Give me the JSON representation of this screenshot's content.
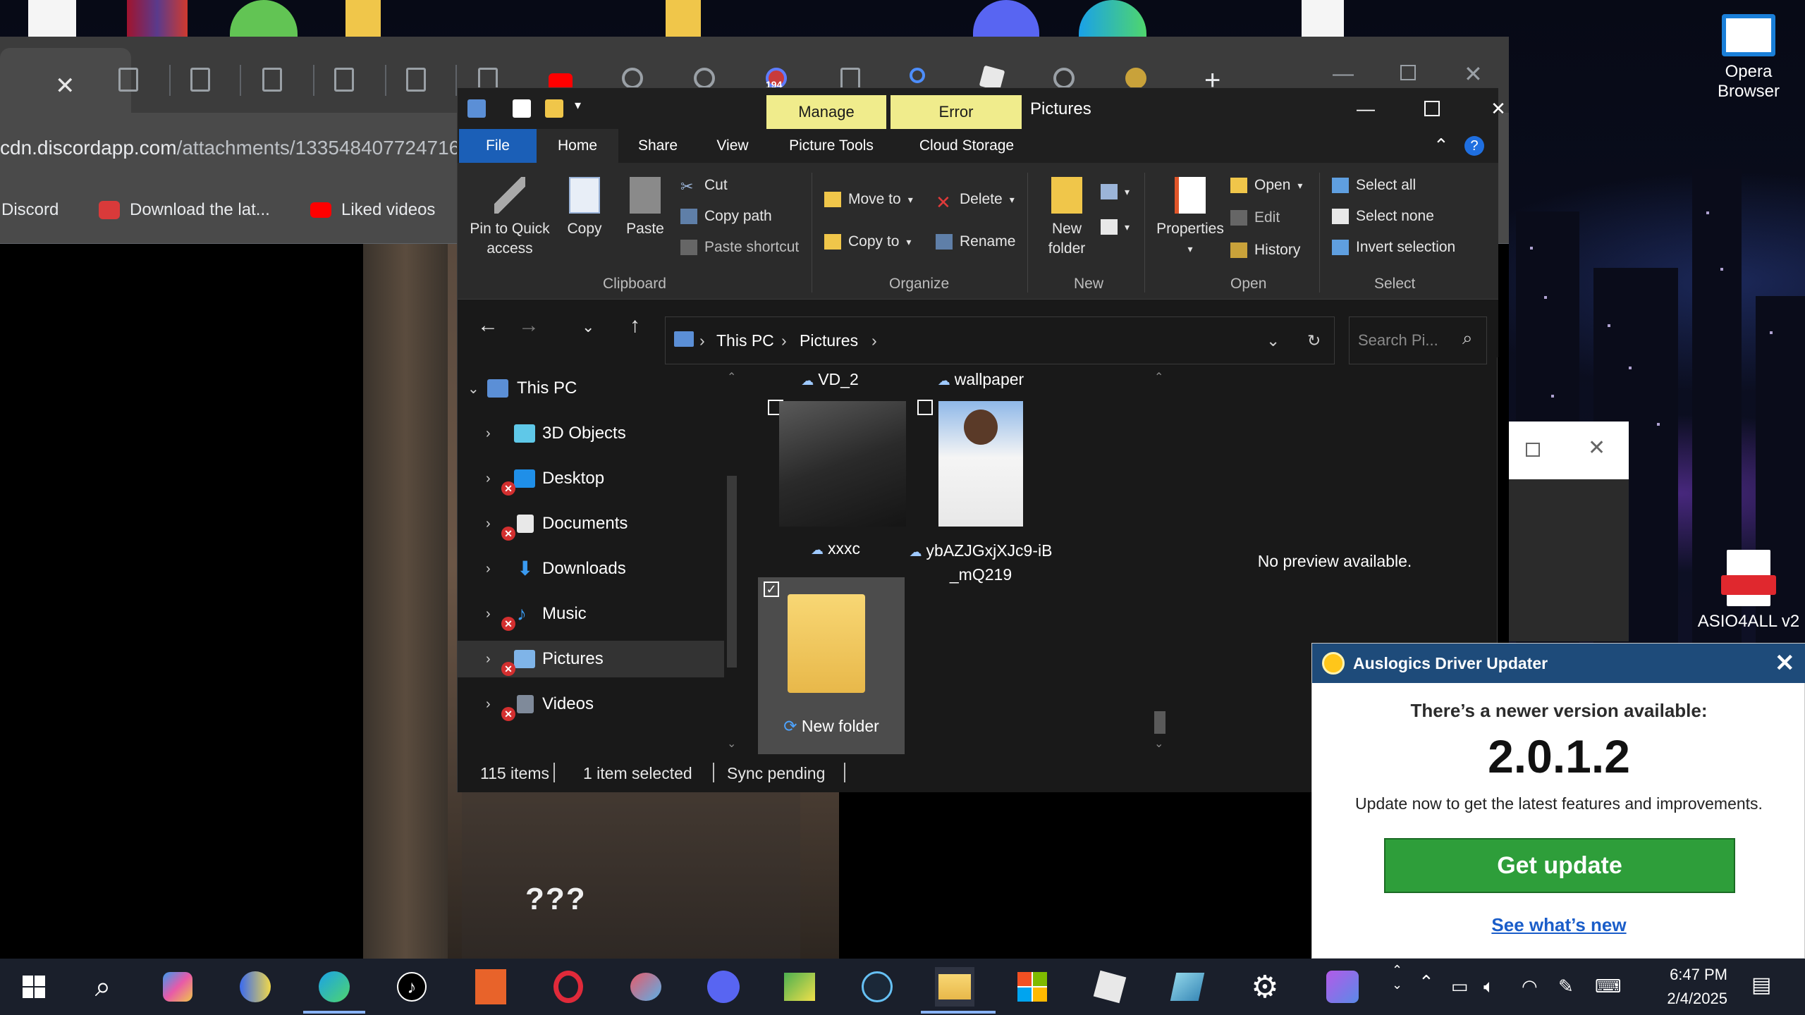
{
  "browser": {
    "url_host": "cdn.discordapp.com",
    "url_path": "/attachments/133548407724716",
    "bookmarks": [
      {
        "label": "Discord"
      },
      {
        "label": "Download the lat..."
      },
      {
        "label": "Liked videos"
      }
    ],
    "tab_badge": "194",
    "video_caption": "???"
  },
  "explorer": {
    "context_tabs": [
      "Manage",
      "Error"
    ],
    "title": "Pictures",
    "menu": [
      "File",
      "Home",
      "Share",
      "View",
      "Picture Tools",
      "Cloud Storage"
    ],
    "ribbon": {
      "clipboard": {
        "pin_label": "Pin to Quick access",
        "copy_label": "Copy",
        "paste_label": "Paste",
        "cut_label": "Cut",
        "copy_path_label": "Copy path",
        "paste_shortcut_label": "Paste shortcut",
        "group_label": "Clipboard"
      },
      "organize": {
        "move_to_label": "Move to",
        "copy_to_label": "Copy to",
        "delete_label": "Delete",
        "rename_label": "Rename",
        "group_label": "Organize"
      },
      "new": {
        "new_folder_label": "New folder",
        "group_label": "New"
      },
      "open": {
        "properties_label": "Properties",
        "open_label": "Open",
        "edit_label": "Edit",
        "history_label": "History",
        "group_label": "Open"
      },
      "select": {
        "select_all_label": "Select all",
        "select_none_label": "Select none",
        "invert_label": "Invert selection",
        "group_label": "Select"
      }
    },
    "breadcrumb": [
      "This PC",
      "Pictures"
    ],
    "search_placeholder": "Search Pi...",
    "nav_tree": [
      {
        "label": "This PC"
      },
      {
        "label": "3D Objects"
      },
      {
        "label": "Desktop"
      },
      {
        "label": "Documents"
      },
      {
        "label": "Downloads"
      },
      {
        "label": "Music"
      },
      {
        "label": "Pictures"
      },
      {
        "label": "Videos"
      }
    ],
    "files": [
      {
        "name": "VD_2"
      },
      {
        "name": "wallpaper"
      },
      {
        "name": "xxxc"
      },
      {
        "name": "ybAZJGxjXJc9-iB_mQ219"
      },
      {
        "name": "New folder"
      }
    ],
    "preview_text": "No preview available.",
    "status": {
      "items": "115 items",
      "selected": "1 item selected",
      "sync": "Sync pending"
    }
  },
  "desktop_icons": [
    {
      "label": "Opera Browser"
    },
    {
      "label": "ASIO4ALL v2"
    }
  ],
  "auslogics": {
    "title": "Auslogics Driver Updater",
    "newer_text": "There’s a newer version available:",
    "version": "2.0.1.2",
    "description": "Update now to get the latest features and improvements.",
    "button_label": "Get update",
    "link_label": "See what’s new"
  },
  "taskbar": {
    "time": "6:47 PM",
    "date": "2/4/2025"
  },
  "colors": {
    "accent_blue": "#1b5fb7",
    "context_tab_yellow": "#f0ec8c",
    "auslogics_header": "#1e4b7a",
    "auslogics_button": "#2e9e3a",
    "link_blue": "#1a5dc9"
  }
}
